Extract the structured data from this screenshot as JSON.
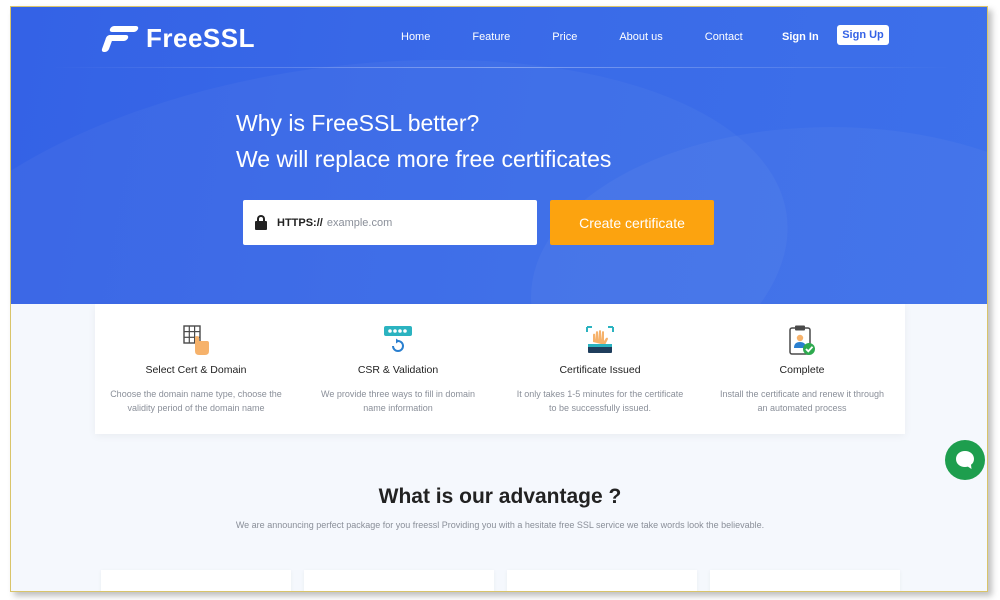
{
  "brand": {
    "name": "FreeSSL"
  },
  "nav": {
    "items": [
      {
        "label": "Home"
      },
      {
        "label": "Feature"
      },
      {
        "label": "Price"
      },
      {
        "label": "About us"
      },
      {
        "label": "Contact"
      }
    ],
    "sign_in": "Sign In",
    "sign_up": "Sign Up"
  },
  "hero": {
    "title_line1": "Why is FreeSSL better?",
    "title_line2": "We will replace more free certificates",
    "protocol_label": "HTTPS://",
    "domain_placeholder": "example.com",
    "create_button": "Create certificate"
  },
  "steps": [
    {
      "title": "Select Cert & Domain",
      "desc": "Choose the domain name type, choose the validity period of the domain name",
      "icon": "grid-hand-icon"
    },
    {
      "title": "CSR & Validation",
      "desc": "We provide three ways to fill in domain name information",
      "icon": "password-refresh-icon"
    },
    {
      "title": "Certificate Issued",
      "desc": "It only takes 1-5 minutes for the certificate to be successfully issued.",
      "icon": "certificate-issued-icon"
    },
    {
      "title": "Complete",
      "desc": "Install the certificate and renew it through an automated process",
      "icon": "clipboard-check-icon"
    }
  ],
  "advantage": {
    "title": "What is our advantage ?",
    "subtitle": "We are announcing perfect package for you freessl Providing you with a hesitate free SSL service we take words look the believable."
  },
  "colors": {
    "hero_blue": "#3462e6",
    "cta_orange": "#fca30f",
    "chat_green": "#1e9e4e"
  }
}
